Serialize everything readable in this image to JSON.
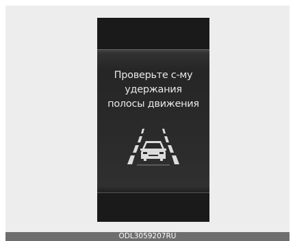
{
  "display": {
    "message_lines": [
      "Проверьте с-му",
      "удержания",
      "полосы движения"
    ],
    "icon": "lane-keeping-assist-icon",
    "colors": {
      "screen": "#1a1a1a",
      "text": "#e8e8e8"
    }
  },
  "caption": {
    "code": "ODL3059207RU"
  }
}
